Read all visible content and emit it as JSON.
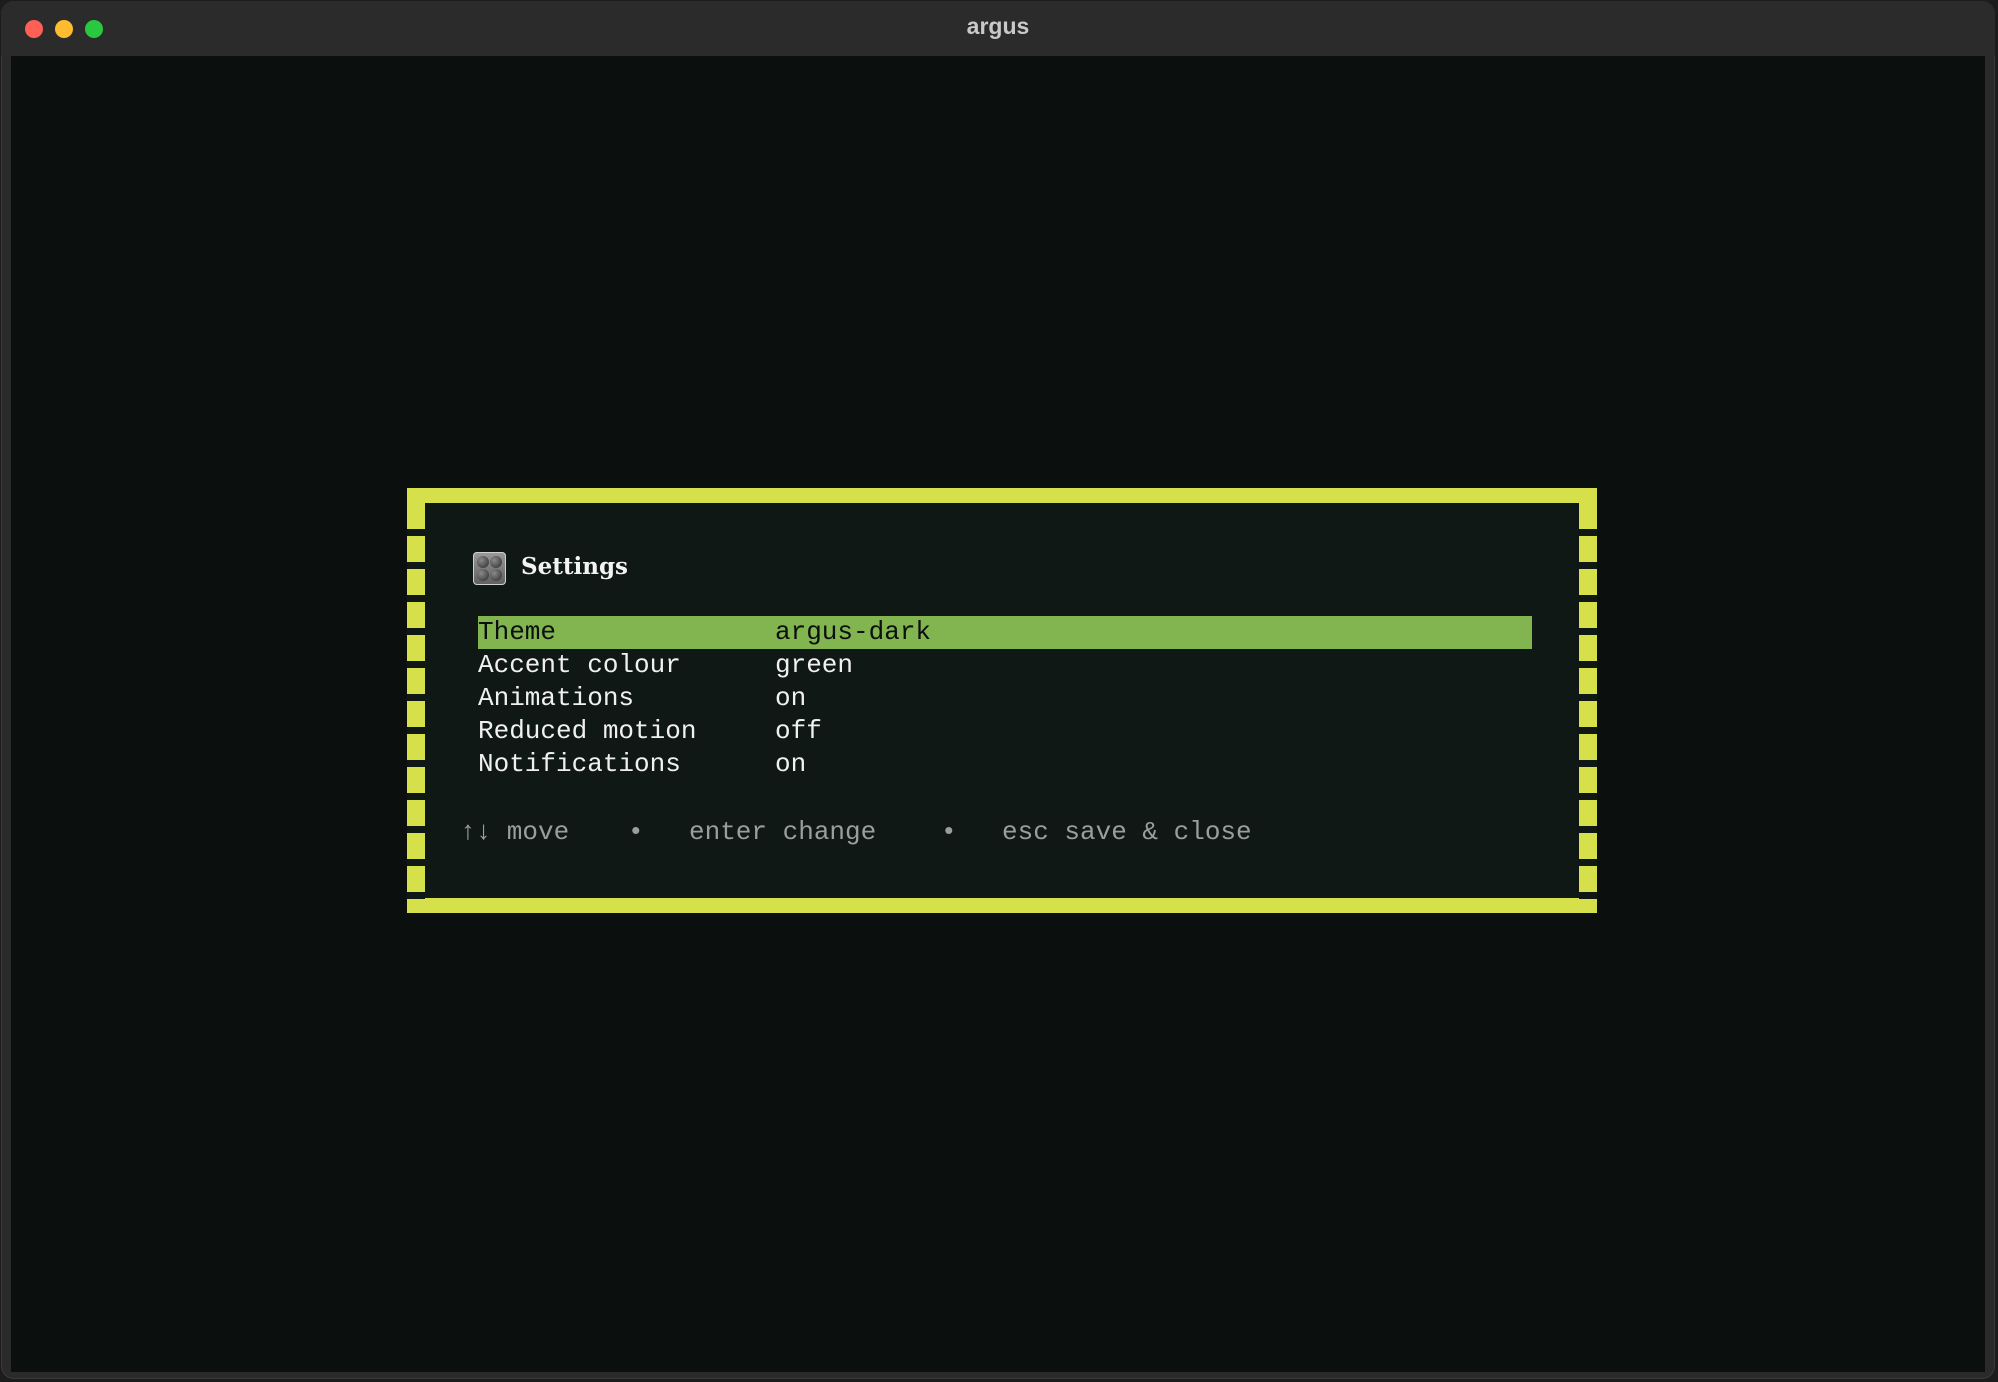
{
  "window": {
    "title": "argus"
  },
  "dialog": {
    "icon": "settings-panel-icon",
    "title": "Settings",
    "rows": [
      {
        "label": "Theme",
        "value": "argus-dark",
        "selected": true
      },
      {
        "label": "Accent colour",
        "value": "green",
        "selected": false
      },
      {
        "label": "Animations",
        "value": "on",
        "selected": false
      },
      {
        "label": "Reduced motion",
        "value": "off",
        "selected": false
      },
      {
        "label": "Notifications",
        "value": "on",
        "selected": false
      }
    ],
    "hints": {
      "move": "↑↓ move",
      "sep1": "•",
      "change": "enter change",
      "sep2": "•",
      "close": "esc save & close"
    }
  },
  "colors": {
    "border": "#d6e04a",
    "selection": "#82b450",
    "background": "#0b0f0e",
    "panel": "#101816"
  }
}
